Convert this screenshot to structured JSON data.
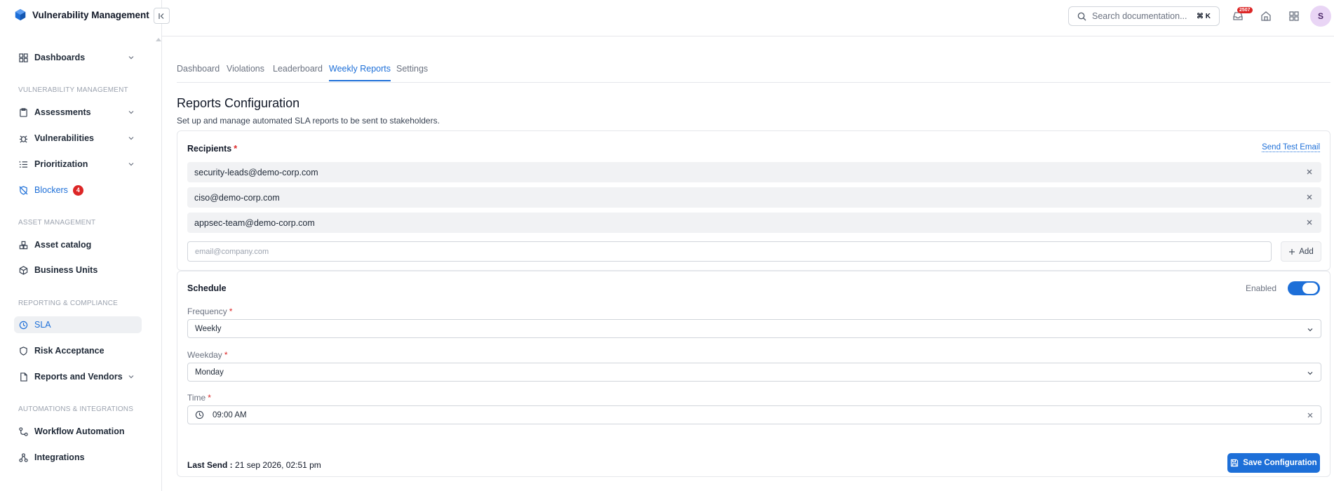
{
  "app": {
    "title": "Vulnerability Management"
  },
  "sidebar": {
    "items": [
      {
        "label": "Dashboards"
      },
      {
        "label": "Assessments"
      },
      {
        "label": "Vulnerabilities"
      },
      {
        "label": "Prioritization"
      },
      {
        "label": "Blockers",
        "badge": "4"
      },
      {
        "label": "Asset catalog"
      },
      {
        "label": "Business Units"
      },
      {
        "label": "SLA"
      },
      {
        "label": "Risk Acceptance"
      },
      {
        "label": "Reports and Vendors"
      },
      {
        "label": "Workflow Automation"
      },
      {
        "label": "Integrations"
      }
    ],
    "sections": {
      "vuln": "VULNERABILITY MANAGEMENT",
      "asset": "ASSET MANAGEMENT",
      "reporting": "REPORTING & COMPLIANCE",
      "automation": "AUTOMATIONS & INTEGRATIONS"
    }
  },
  "topbar": {
    "search_placeholder": "Search documentation...",
    "shortcut": "⌘ K",
    "notification_count": "2507",
    "avatar_initial": "S"
  },
  "tabs": [
    {
      "label": "Dashboard"
    },
    {
      "label": "Violations"
    },
    {
      "label": "Leaderboard"
    },
    {
      "label": "Weekly Reports",
      "active": true
    },
    {
      "label": "Settings"
    }
  ],
  "page": {
    "title": "Reports Configuration",
    "subtitle": "Set up and manage automated SLA reports to be sent to stakeholders."
  },
  "recipients": {
    "title": "Recipients",
    "required_mark": "*",
    "send_test_label": "Send Test Email",
    "emails": [
      "security-leads@demo-corp.com",
      "ciso@demo-corp.com",
      "appsec-team@demo-corp.com"
    ],
    "input_placeholder": "email@company.com",
    "add_label": "Add"
  },
  "schedule": {
    "title": "Schedule",
    "enabled_label": "Enabled",
    "enabled": true,
    "frequency_label": "Frequency",
    "frequency_value": "Weekly",
    "weekday_label": "Weekday",
    "weekday_value": "Monday",
    "time_label": "Time",
    "time_value": "09:00 AM",
    "last_send_label": "Last Send :",
    "last_send_value": "21 sep 2026, 02:51 pm",
    "save_label": "Save Configuration"
  },
  "colors": {
    "accent": "#1d6fd8",
    "danger": "#dc2626"
  }
}
